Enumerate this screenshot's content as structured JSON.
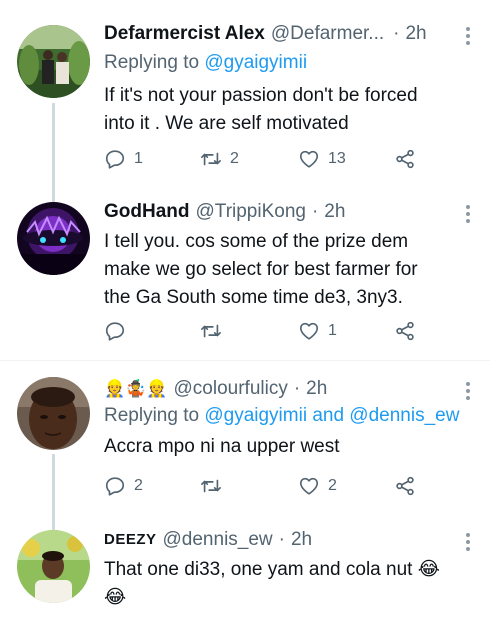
{
  "tweets": [
    {
      "name": "Defarmercist Alex",
      "handle": "@Defarmer...",
      "sep": "·",
      "time": "2h",
      "reply_prefix": "Replying to ",
      "reply_users": "@gyaigyimii",
      "text_line1": "If it's not your passion don't be forced",
      "text_line2": "into it . We are self motivated",
      "replies": "1",
      "retweets": "2",
      "likes": "13"
    },
    {
      "name": "GodHand",
      "handle": "@TrippiKong",
      "sep": "·",
      "time": "2h",
      "text_line1": "I tell you. cos some of the prize dem",
      "text_line2": "make we go select for best farmer for",
      "text_line3": "the Ga South some time de3, 3ny3.",
      "replies": "",
      "retweets": "",
      "likes": "1"
    },
    {
      "name": "👷🤹👷",
      "handle": "@colourfulicy",
      "sep": "·",
      "time": "2h",
      "reply_prefix": "Replying to ",
      "reply_users": "@gyaigyimii and @dennis_ew",
      "text_line1": "Accra mpo ni na upper west",
      "replies": "2",
      "retweets": "",
      "likes": "2"
    },
    {
      "name": "DEEZY",
      "handle": "@dennis_ew",
      "sep": "·",
      "time": "2h",
      "text_line1": "That one di33, one yam and cola nut 😂",
      "text_line2": "😂"
    }
  ],
  "icons": {
    "reply": "reply-icon",
    "retweet": "retweet-icon",
    "like": "heart-icon",
    "share": "share-icon",
    "more": "more-icon"
  },
  "colors": {
    "link": "#1d9bf0",
    "secondary_text": "#536471",
    "thread_line": "#cfd9de"
  }
}
